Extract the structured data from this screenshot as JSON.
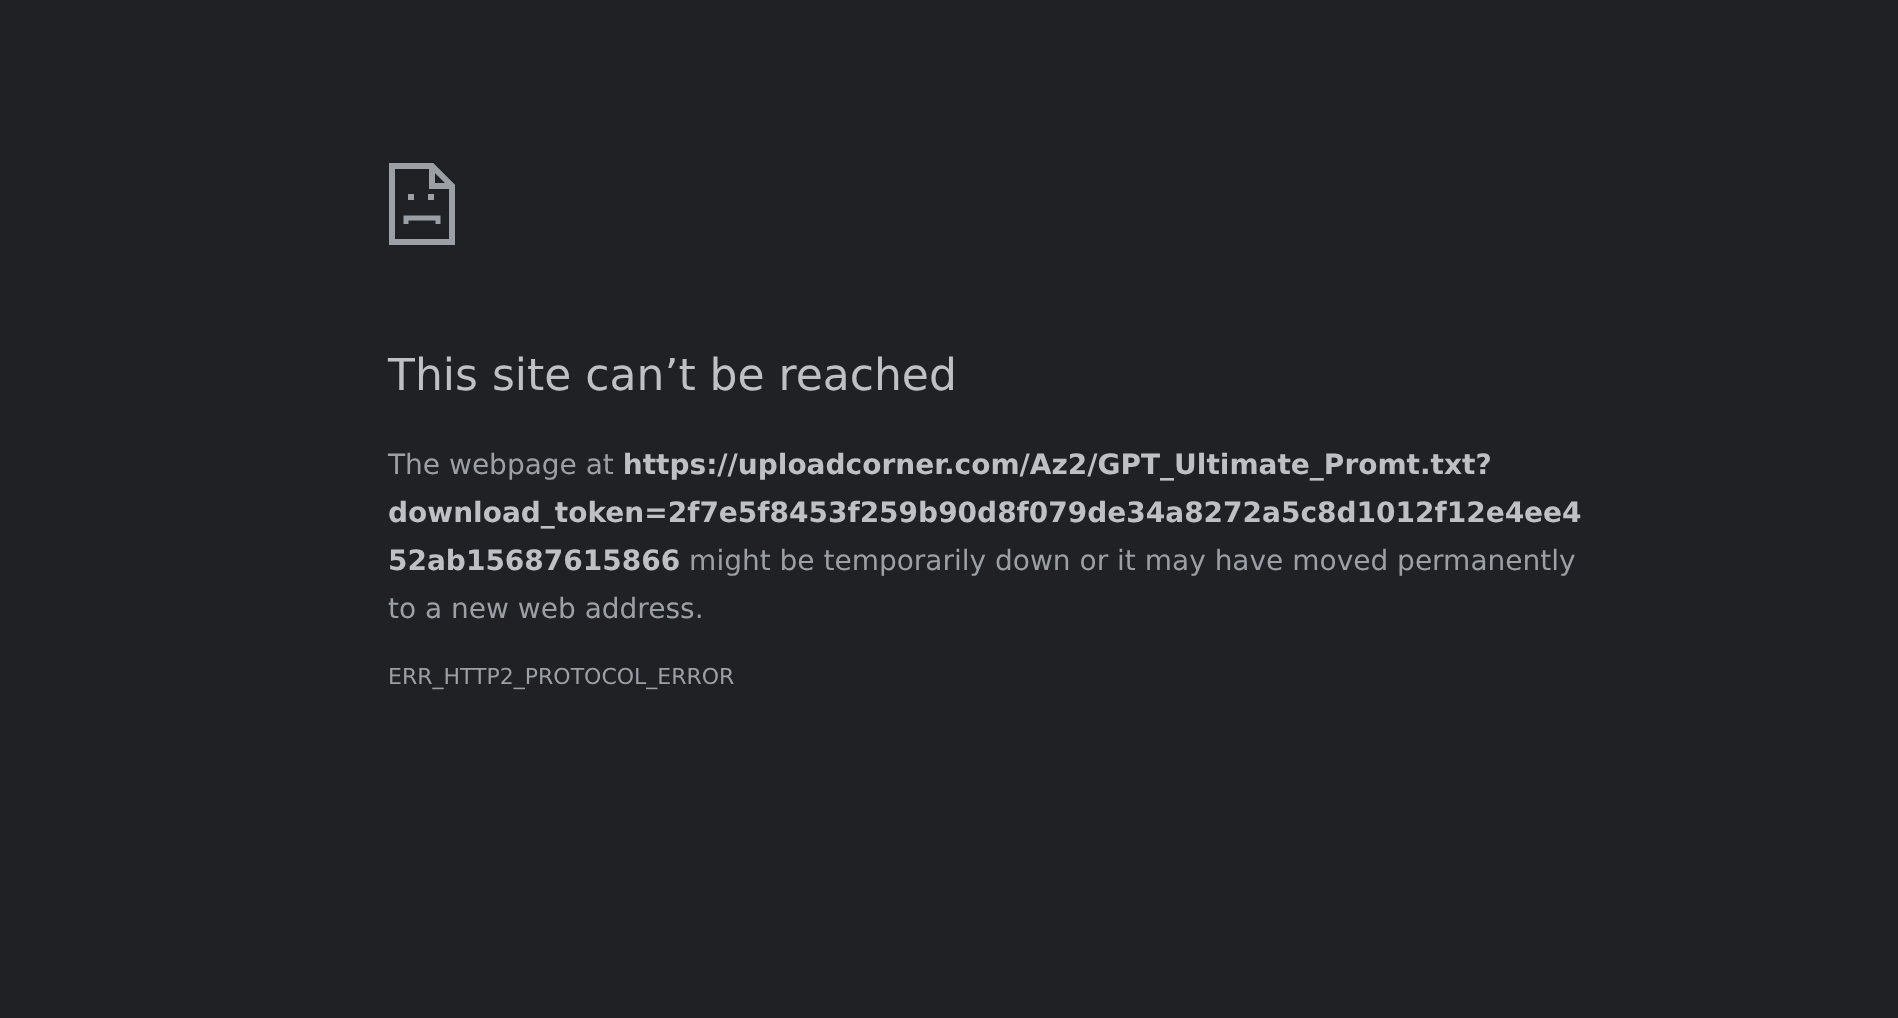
{
  "title": "This site can’t be reached",
  "message": "The webpage at **https://uploadcorner.com/Az2/GPT_Ultimate_Promt.txt?download_token=2f7e5f8453f259b90d8f079de34a8272a5c8d1012f12e4ee452ab15687615866** might be temporarily down or it may have moved permanently to a new web address.",
  "error_code": "ERR_HTTP2_PROTOCOL_ERROR"
}
